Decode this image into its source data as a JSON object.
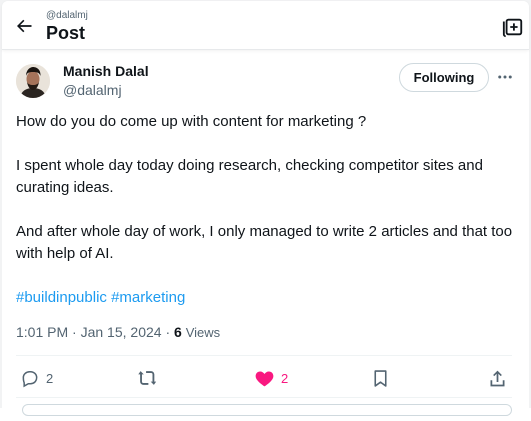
{
  "header": {
    "handle": "@dalalmj",
    "title": "Post"
  },
  "author": {
    "name": "Manish Dalal",
    "handle": "@dalalmj",
    "follow_label": "Following"
  },
  "post": {
    "paragraph1": "How do you do come up with content for marketing ?",
    "paragraph2": "I spent whole day today doing research, checking competitor sites and curating ideas.",
    "paragraph3": "And after whole day of work, I only managed to write 2 articles and that too with help of AI.",
    "hashtags": [
      "#buildinpublic",
      "#marketing"
    ]
  },
  "meta": {
    "time": "1:01 PM",
    "date": "Jan 15, 2024",
    "views_count": "6",
    "views_label": "Views"
  },
  "actions": {
    "replies": "2",
    "likes": "2"
  },
  "colors": {
    "accent": "#1d9bf0",
    "like": "#f91880",
    "secondary_text": "#536471"
  }
}
